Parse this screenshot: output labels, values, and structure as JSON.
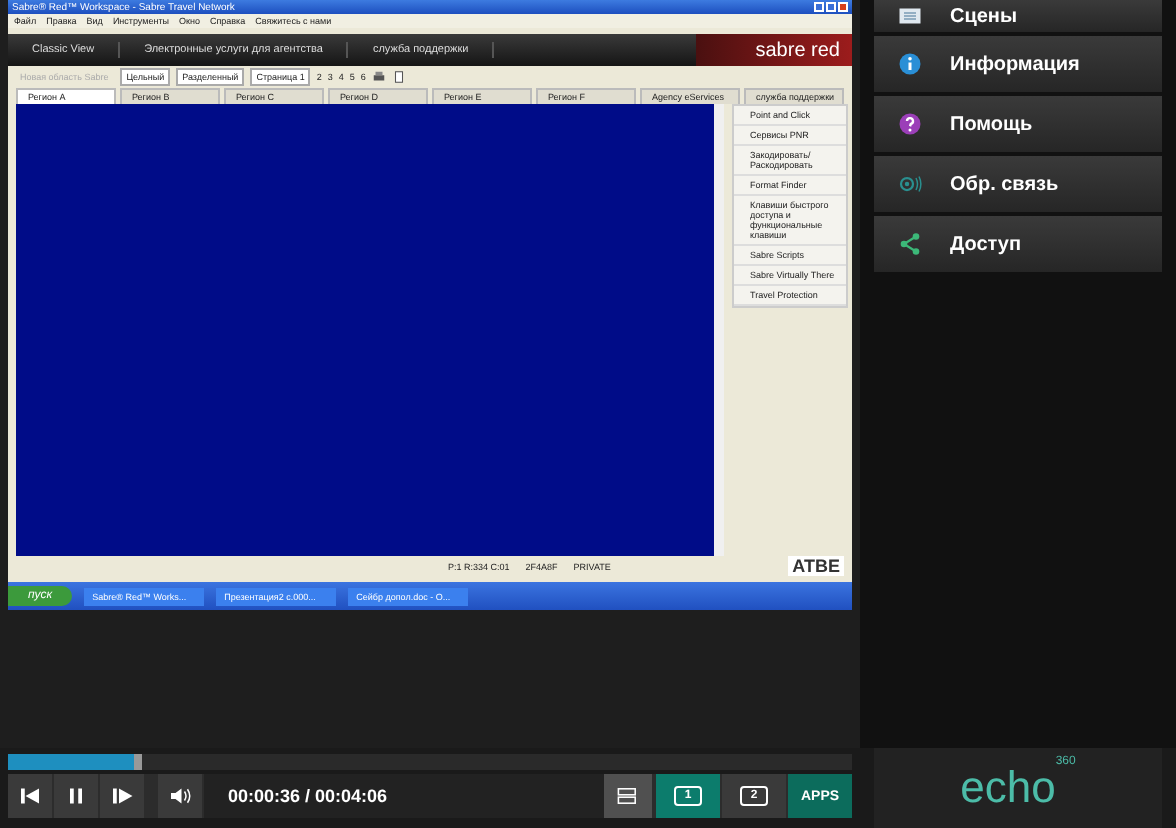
{
  "recording": {
    "window": {
      "title": "Sabre® Red™ Workspace - Sabre Travel Network"
    },
    "menu": [
      "Файл",
      "Правка",
      "Вид",
      "Инструменты",
      "Окно",
      "Справка",
      "Свяжитесь с нами"
    ],
    "nav_tabs": [
      "Classic View",
      "Электронные услуги для агентства",
      "служба поддержки"
    ],
    "brand": "sabre red",
    "toolbar": {
      "new_area": {
        "label": "Новая область Sabre",
        "disabled": true
      },
      "layouts": [
        {
          "label": "Цельный",
          "selected": false
        },
        {
          "label": "Разделенный",
          "selected": false
        }
      ],
      "page": "Страница 1",
      "pages": [
        "2",
        "3",
        "4",
        "5",
        "6"
      ]
    },
    "tabs": [
      {
        "label": "Регион A",
        "selected": true
      },
      {
        "label": "Регион B",
        "selected": false
      },
      {
        "label": "Регион C",
        "selected": false
      },
      {
        "label": "Регион D",
        "selected": false
      },
      {
        "label": "Регион E",
        "selected": false
      },
      {
        "label": "Регион F",
        "selected": false
      },
      {
        "label": "Agency eServices",
        "selected": false
      },
      {
        "label": "служба поддержки",
        "selected": false
      }
    ],
    "side_links": [
      "Point and Click",
      "Сервисы PNR",
      "Закодировать/ Раскодировать",
      "Format Finder",
      "Клавиши быстрого доступа и функциональные клавиши",
      "Sabre Scripts",
      "Sabre Virtually There",
      "Travel Protection"
    ],
    "status": [
      "P:1 R:334 C:01",
      "2F4A8F",
      "PRIVATE"
    ],
    "logo": "ATBE",
    "taskbar": {
      "start": "пуск",
      "items": [
        "Sabre® Red™ Works...",
        "Презентация2 с.000...",
        "Сейбр допол.doc - O..."
      ]
    }
  },
  "sidebar": {
    "items": [
      {
        "kind": "scenes",
        "label": "Сцены"
      },
      {
        "kind": "info",
        "label": "Информация"
      },
      {
        "kind": "help",
        "label": "Помощь"
      },
      {
        "kind": "feedback",
        "label": "Обр. связь"
      },
      {
        "kind": "share",
        "label": "Доступ"
      }
    ]
  },
  "player": {
    "progress": {
      "level": 0.15
    },
    "time": "00:00:36 / 00:04:06",
    "screens": [
      {
        "label": "1",
        "selected": true
      },
      {
        "label": "2",
        "selected": false
      }
    ],
    "apps": "APPS",
    "logo": "echo",
    "logo_sup": "360"
  }
}
